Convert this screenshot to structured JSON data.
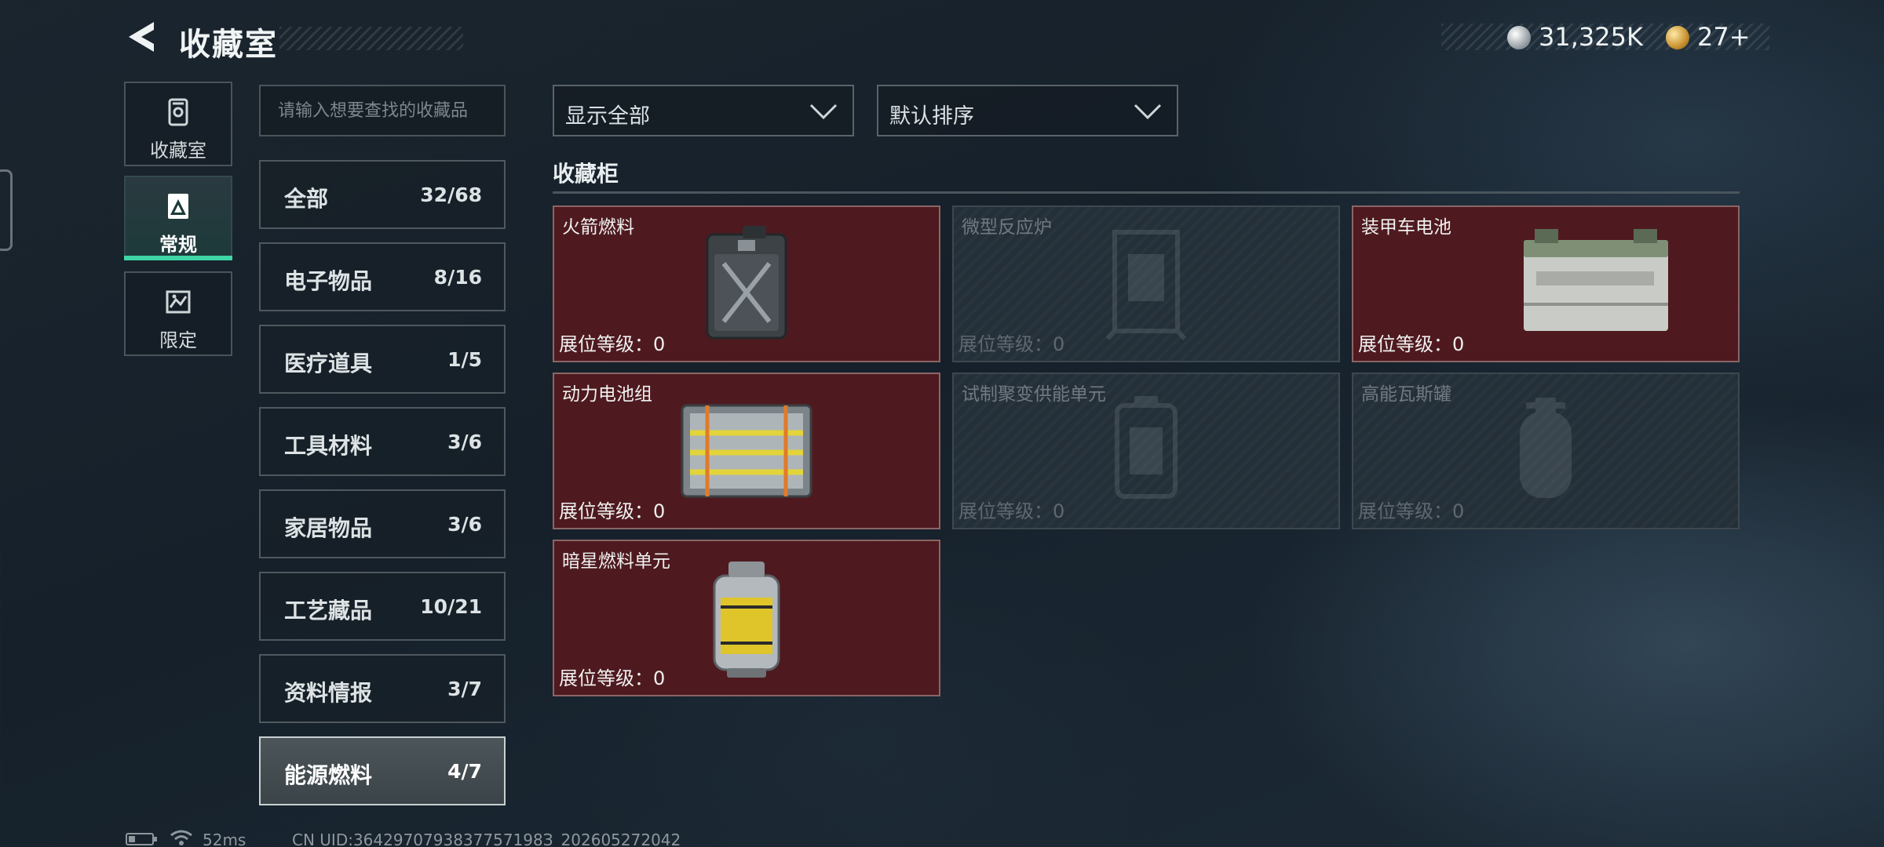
{
  "header": {
    "title": "收藏室",
    "back_icon": "back-arrow-icon",
    "currencies": [
      {
        "icon": "silver-coin-icon",
        "value": "31,325K"
      },
      {
        "icon": "gold-coin-icon",
        "value": "27+"
      }
    ]
  },
  "side_tabs": [
    {
      "label": "收藏室",
      "icon": "collection-room-icon",
      "active": false
    },
    {
      "label": "常规",
      "icon": "regular-icon",
      "active": true
    },
    {
      "label": "限定",
      "icon": "limited-icon",
      "active": false
    }
  ],
  "search": {
    "placeholder": "请输入想要查找的收藏品",
    "value": ""
  },
  "categories": [
    {
      "name": "全部",
      "count": "32/68"
    },
    {
      "name": "电子物品",
      "count": "8/16"
    },
    {
      "name": "医疗道具",
      "count": "1/5"
    },
    {
      "name": "工具材料",
      "count": "3/6"
    },
    {
      "name": "家居物品",
      "count": "3/6"
    },
    {
      "name": "工艺藏品",
      "count": "10/21"
    },
    {
      "name": "资料情报",
      "count": "3/7"
    },
    {
      "name": "能源燃料",
      "count": "4/7",
      "selected": true
    }
  ],
  "filters": {
    "display": "显示全部",
    "sort": "默认排序"
  },
  "section": {
    "title": "收藏柜"
  },
  "items": [
    {
      "name": "火箭燃料",
      "level": "展位等级：0",
      "owned": true,
      "icon": "fuel-canister-icon"
    },
    {
      "name": "微型反应炉",
      "level": "展位等级：0",
      "owned": false,
      "icon": "mini-reactor-icon"
    },
    {
      "name": "装甲车电池",
      "level": "展位等级：0",
      "owned": true,
      "icon": "vehicle-battery-icon"
    },
    {
      "name": "动力电池组",
      "level": "展位等级：0",
      "owned": true,
      "icon": "battery-pack-icon"
    },
    {
      "name": "试制聚变供能单元",
      "level": "展位等级：0",
      "owned": false,
      "icon": "fusion-cell-icon"
    },
    {
      "name": "高能瓦斯罐",
      "level": "展位等级：0",
      "owned": false,
      "icon": "gas-tank-icon"
    },
    {
      "name": "暗星燃料单元",
      "level": "展位等级：0",
      "owned": true,
      "icon": "darkstar-fuel-cell-icon"
    }
  ],
  "footer": {
    "battery_icon": "battery-icon",
    "wifi_icon": "wifi-icon",
    "ping": "52ms",
    "uid": "CN UID:3642970793837757198З_202605272042"
  },
  "colors": {
    "accent_green": "#3fd6a6",
    "owned_card": "#4e1a1f",
    "locked_card": "#2a343c"
  }
}
